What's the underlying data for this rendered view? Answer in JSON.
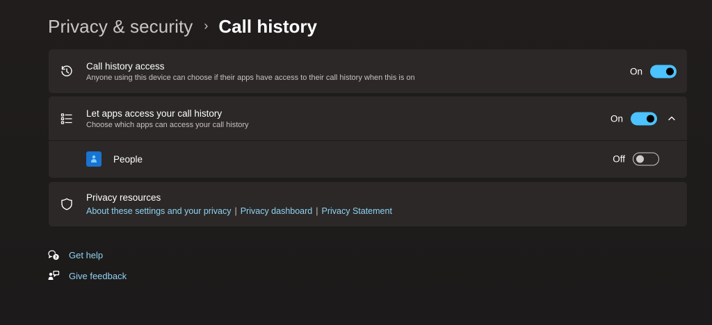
{
  "breadcrumb": {
    "parent": "Privacy & security",
    "separator": "›",
    "current": "Call history"
  },
  "call_history_access": {
    "title": "Call history access",
    "subtitle": "Anyone using this device can choose if their apps have access to their call history when this is on",
    "state_label": "On",
    "enabled": true,
    "icon": "history-icon"
  },
  "let_apps_access": {
    "title": "Let apps access your call history",
    "subtitle": "Choose which apps can access your call history",
    "state_label": "On",
    "enabled": true,
    "expanded": true,
    "icon": "list-icon",
    "apps": [
      {
        "name": "People",
        "state_label": "Off",
        "enabled": false,
        "icon": "people-app-icon"
      }
    ]
  },
  "privacy_resources": {
    "title": "Privacy resources",
    "icon": "shield-icon",
    "links": [
      "About these settings and your privacy",
      "Privacy dashboard",
      "Privacy Statement"
    ],
    "separator": "|"
  },
  "help": {
    "get_help": "Get help",
    "give_feedback": "Give feedback"
  },
  "colors": {
    "accent": "#4cc2ff",
    "link": "#8fd3f2",
    "card": "#2b2827",
    "background": "#1f1c1c"
  }
}
